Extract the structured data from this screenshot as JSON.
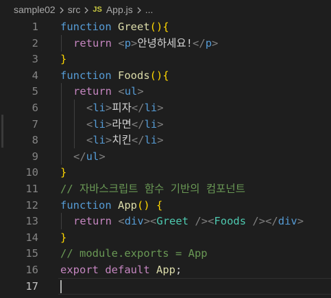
{
  "breadcrumb": {
    "folder": "sample02",
    "subfolder": "src",
    "file_badge": "JS",
    "file": "App.js",
    "more": "..."
  },
  "colors": {
    "keyword": "#569cd6",
    "control": "#c586c0",
    "function": "#dcdcaa",
    "tag": "#569cd6",
    "bracket": "#808080",
    "component": "#4ec9b0",
    "comment": "#6a9955",
    "text": "#d4d4d4",
    "brace": "#ffd700"
  },
  "lines": [
    {
      "num": "1",
      "indent": 0,
      "tokens": [
        {
          "t": "function",
          "c": "keyword"
        },
        {
          "t": " "
        },
        {
          "t": "Greet",
          "c": "function"
        },
        {
          "t": "()",
          "c": "brace"
        },
        {
          "t": "{",
          "c": "brace"
        }
      ]
    },
    {
      "num": "2",
      "indent": 1,
      "tokens": [
        {
          "t": "return",
          "c": "control"
        },
        {
          "t": " "
        },
        {
          "t": "<",
          "c": "bracket"
        },
        {
          "t": "p",
          "c": "tag"
        },
        {
          "t": ">",
          "c": "bracket"
        },
        {
          "t": "안녕하세요!"
        },
        {
          "t": "</",
          "c": "bracket"
        },
        {
          "t": "p",
          "c": "tag"
        },
        {
          "t": ">",
          "c": "bracket"
        }
      ]
    },
    {
      "num": "3",
      "indent": 0,
      "tokens": [
        {
          "t": "}",
          "c": "brace"
        }
      ]
    },
    {
      "num": "4",
      "indent": 0,
      "tokens": [
        {
          "t": "function",
          "c": "keyword"
        },
        {
          "t": " "
        },
        {
          "t": "Foods",
          "c": "function"
        },
        {
          "t": "()",
          "c": "brace"
        },
        {
          "t": "{",
          "c": "brace"
        }
      ]
    },
    {
      "num": "5",
      "indent": 1,
      "tokens": [
        {
          "t": "return",
          "c": "control"
        },
        {
          "t": " "
        },
        {
          "t": "<",
          "c": "bracket"
        },
        {
          "t": "ul",
          "c": "tag"
        },
        {
          "t": ">",
          "c": "bracket"
        }
      ]
    },
    {
      "num": "6",
      "indent": 2,
      "tokens": [
        {
          "t": "<",
          "c": "bracket"
        },
        {
          "t": "li",
          "c": "tag"
        },
        {
          "t": ">",
          "c": "bracket"
        },
        {
          "t": "피자"
        },
        {
          "t": "</",
          "c": "bracket"
        },
        {
          "t": "li",
          "c": "tag"
        },
        {
          "t": ">",
          "c": "bracket"
        }
      ]
    },
    {
      "num": "7",
      "indent": 2,
      "tokens": [
        {
          "t": "<",
          "c": "bracket"
        },
        {
          "t": "li",
          "c": "tag"
        },
        {
          "t": ">",
          "c": "bracket"
        },
        {
          "t": "라면"
        },
        {
          "t": "</",
          "c": "bracket"
        },
        {
          "t": "li",
          "c": "tag"
        },
        {
          "t": ">",
          "c": "bracket"
        }
      ]
    },
    {
      "num": "8",
      "indent": 2,
      "tokens": [
        {
          "t": "<",
          "c": "bracket"
        },
        {
          "t": "li",
          "c": "tag"
        },
        {
          "t": ">",
          "c": "bracket"
        },
        {
          "t": "치킨"
        },
        {
          "t": "</",
          "c": "bracket"
        },
        {
          "t": "li",
          "c": "tag"
        },
        {
          "t": ">",
          "c": "bracket"
        }
      ]
    },
    {
      "num": "9",
      "indent": 1,
      "tokens": [
        {
          "t": "</",
          "c": "bracket"
        },
        {
          "t": "ul",
          "c": "tag"
        },
        {
          "t": ">",
          "c": "bracket"
        }
      ]
    },
    {
      "num": "10",
      "indent": 0,
      "tokens": [
        {
          "t": "}",
          "c": "brace"
        }
      ]
    },
    {
      "num": "11",
      "indent": 0,
      "tokens": [
        {
          "t": "// 자바스크립트 함수 기반의 컴포넌트",
          "c": "comment"
        }
      ]
    },
    {
      "num": "12",
      "indent": 0,
      "tokens": [
        {
          "t": "function",
          "c": "keyword"
        },
        {
          "t": " "
        },
        {
          "t": "App",
          "c": "function"
        },
        {
          "t": "()",
          "c": "brace"
        },
        {
          "t": " "
        },
        {
          "t": "{",
          "c": "brace"
        }
      ]
    },
    {
      "num": "13",
      "indent": 1,
      "tokens": [
        {
          "t": "return",
          "c": "control"
        },
        {
          "t": " "
        },
        {
          "t": "<",
          "c": "bracket"
        },
        {
          "t": "div",
          "c": "tag"
        },
        {
          "t": ">",
          "c": "bracket"
        },
        {
          "t": "<",
          "c": "bracket"
        },
        {
          "t": "Greet",
          "c": "component"
        },
        {
          "t": " "
        },
        {
          "t": "/>",
          "c": "bracket"
        },
        {
          "t": "<",
          "c": "bracket"
        },
        {
          "t": "Foods",
          "c": "component"
        },
        {
          "t": " "
        },
        {
          "t": "/>",
          "c": "bracket"
        },
        {
          "t": "</",
          "c": "bracket"
        },
        {
          "t": "div",
          "c": "tag"
        },
        {
          "t": ">",
          "c": "bracket"
        }
      ]
    },
    {
      "num": "14",
      "indent": 0,
      "tokens": [
        {
          "t": "}",
          "c": "brace"
        }
      ]
    },
    {
      "num": "15",
      "indent": 0,
      "tokens": [
        {
          "t": "// module.exports = App",
          "c": "comment"
        }
      ]
    },
    {
      "num": "16",
      "indent": 0,
      "tokens": [
        {
          "t": "export",
          "c": "control"
        },
        {
          "t": " "
        },
        {
          "t": "default",
          "c": "control"
        },
        {
          "t": " "
        },
        {
          "t": "App",
          "c": "function"
        },
        {
          "t": ";"
        }
      ]
    },
    {
      "num": "17",
      "indent": 0,
      "current": true,
      "tokens": []
    }
  ]
}
